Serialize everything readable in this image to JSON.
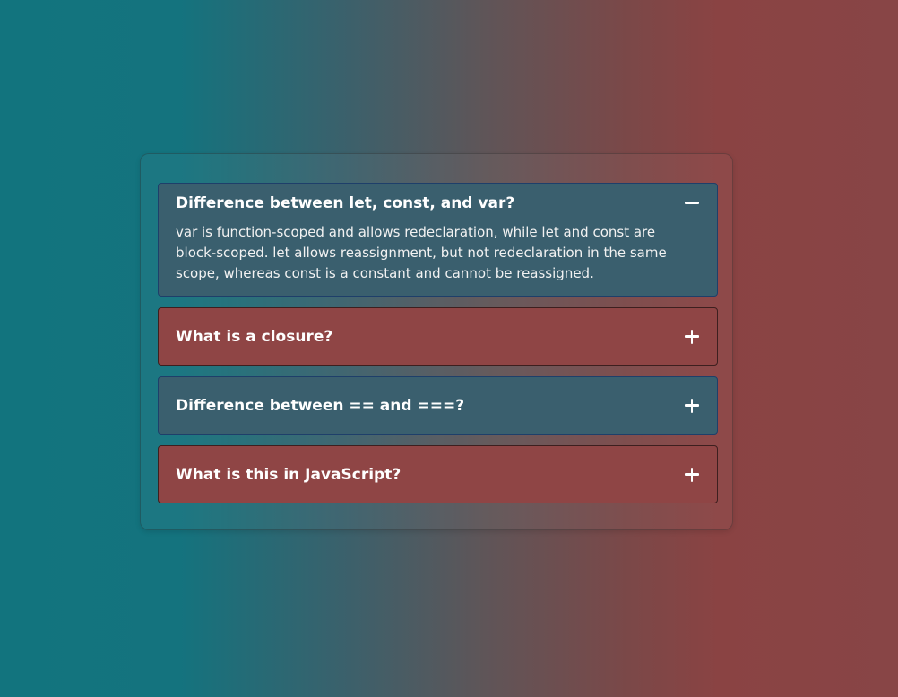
{
  "faq": {
    "items": [
      {
        "question": "Difference between let, const, and var?",
        "answer": "var is function-scoped and allows redeclaration, while let and const are block-scoped. let allows reassignment, but not redeclaration in the same scope, whereas const is a constant and cannot be reassigned.",
        "expanded": true,
        "toggle_icon": "minus-icon",
        "color": "#3a5f6e"
      },
      {
        "question": "What is a closure?",
        "expanded": false,
        "toggle_icon": "plus-icon",
        "color": "#8f4545"
      },
      {
        "question": "Difference between == and ===?",
        "expanded": false,
        "toggle_icon": "plus-icon",
        "color": "#3a5f6e"
      },
      {
        "question": "What is this in JavaScript?",
        "expanded": false,
        "toggle_icon": "plus-icon",
        "color": "#8f4545"
      }
    ]
  },
  "colors": {
    "gradient_left": "#12747e",
    "gradient_right": "#884546",
    "text": "#ffffff"
  }
}
